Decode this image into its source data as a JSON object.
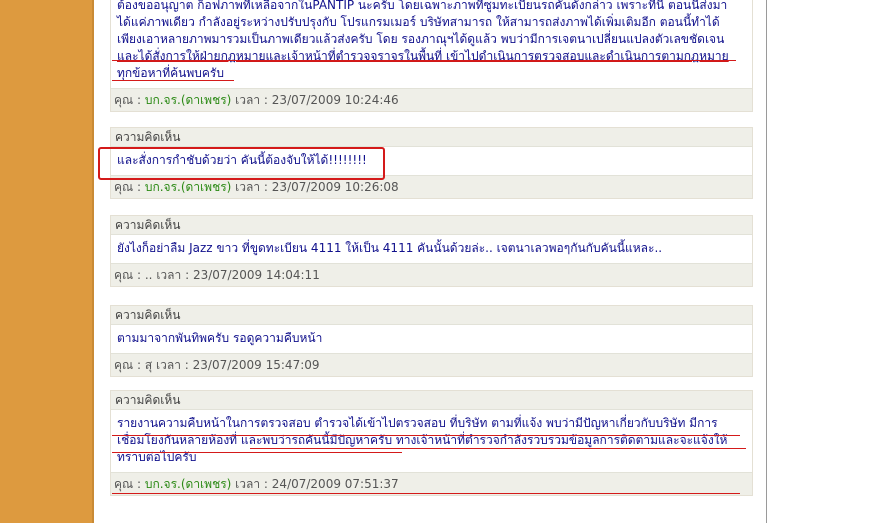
{
  "comments": [
    {
      "lines": [
        "ต้องขออนุญาต ก็อฟภาพที่เหลือจากในPANTIP นะครับ โดยเฉพาะภาพที่ซูมทะเบียนรถคันดังกล่าว เพราะที่นี่ ตอนนี้ส่งมา",
        "ได้แค่ภาพเดียว กำลังอยู่ระหว่างปรับปรุงกับ โปรแกรมเมอร์ บริษัทสามารถ ให้สามารถส่งภาพได้เพิ่มเติมอีก ตอนนี้ทำได้",
        "เพียงเอาหลายภาพมารวมเป็นภาพเดียวแล้วส่งครับ โดย รองภาณุฯได้ดูแล้ว พบว่ามีการเจตนาเปลี่ยนแปลงตัวเลขชัดเจน",
        "และได้สั่งการให้ฝ่ายกฎหมายและเจ้าหน้าที่ตำรวจจราจรในพื้นที่ เข้าไปดำเนินการตรวจสอบและดำเนินการตามกฎหมาย",
        "ทุกข้อหาที่ค้นพบครับ"
      ],
      "author": "บก.จร.(ดาเพชร)",
      "time": "23/07/2009 10:24:46"
    },
    {
      "header": "ความคิดเห็น",
      "lines": [
        "และสั่งการกำชับด้วยว่า คันนี้ต้องจับให้ได้!!!!!!!!"
      ],
      "author": "บก.จร.(ดาเพชร)",
      "time": "23/07/2009 10:26:08"
    },
    {
      "header": "ความคิดเห็น",
      "lines": [
        "ยังไงก็อย่าลืม Jazz ขาว ที่ขูดทะเบียน 4111 ให้เป็น 4111 คันนั้นด้วยล่ะ.. เจตนาเลวพอๆกันกับคันนี้แหละ.."
      ],
      "author": "..",
      "time": "23/07/2009 14:04:11"
    },
    {
      "header": "ความคิดเห็น",
      "lines": [
        "ตามมาจากพันทิพครับ รอดูความคืบหน้า"
      ],
      "author": "สุ",
      "time": "23/07/2009 15:47:09"
    },
    {
      "header": "ความคิดเห็น",
      "lines": [
        "รายงานความคืบหน้าในการตรวจสอบ ตำรวจได้เข้าไปตรวจสอบ ที่บริษัท ตามที่แจ้ง พบว่ามีปัญหาเกี่ยวกับบริษัท มีการ",
        "เชื่อมโยงกันหลายห้องที่ และพบว่ารถคันนี้มีปัญหาครับ ทางเจ้าหน้าที่ตำรวจกำลังรวบรวมข้อมูลการติดตามและจะแจ้งให้",
        "ทราบต่อไปครับ"
      ],
      "author": "บก.จร.(ดาเพชร)",
      "time": "24/07/2009 07:51:37"
    }
  ],
  "labels": {
    "by": "คุณ :",
    "time": "เวลา :"
  },
  "colors": {
    "sidebar": "#dd9a3f",
    "body_text": "#10108c",
    "author_text": "#2c8a16",
    "annotation": "#d41a1a"
  }
}
